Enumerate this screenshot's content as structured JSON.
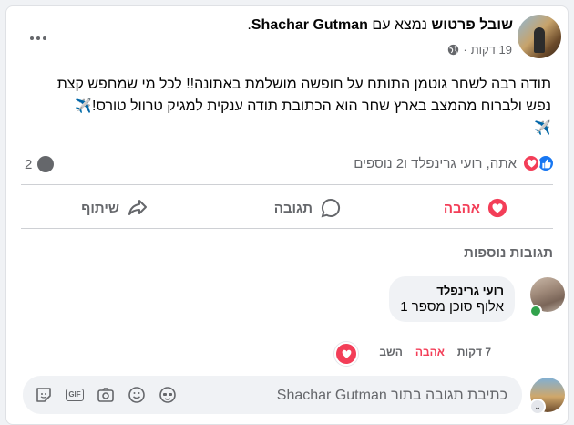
{
  "post": {
    "author": "שובל פרטוש",
    "with_text": "נמצא עם",
    "tagged": "Shachar Gutman",
    "tagged_suffix": ".",
    "time": "19 דקות",
    "separator": "·",
    "body_line1": "תודה רבה לשחר גוטמן התותח על חופשה מושלמת באתונה!! לכל מי שמחפש קצת",
    "body_line2": "נפש ולברוח מהמצב בארץ שחר הוא הכתובת תודה ענקית למגיק טרוול טורס!",
    "plane_emoji": "✈️"
  },
  "reactions": {
    "summary": "אתה, רועי גרינפלד ו2 נוספים",
    "comments_count": "2"
  },
  "actions": {
    "love": "אהבה",
    "comment": "תגובה",
    "share": "שיתוף"
  },
  "more_comments": "תגובות נוספות",
  "comment": {
    "author": "רועי גרינפלד",
    "text": "אלוף סוכן מספר 1",
    "time": "7 דקות",
    "love": "אהבה",
    "reply": "השב"
  },
  "composer": {
    "placeholder": "כתיבת תגובה בתור Shachar Gutman"
  },
  "colors": {
    "love": "#f33e58",
    "like": "#1877f2",
    "muted": "#65676b",
    "online": "#31a24c"
  }
}
